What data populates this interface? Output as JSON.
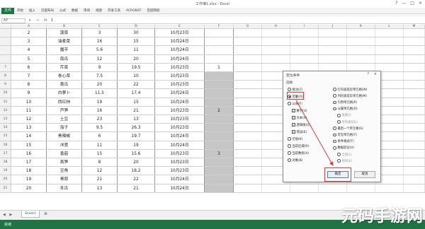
{
  "window": {
    "title": "工作簿1.xlsx - Excel",
    "controls": [
      "?",
      "—",
      "□",
      "×"
    ]
  },
  "ribbon": {
    "file_tab": "文件",
    "tabs": [
      "开始",
      "插入",
      "页面布局",
      "公式",
      "数据",
      "审阅",
      "视图",
      "开发工具",
      "ACROBAT",
      "百度网盘"
    ]
  },
  "formula_bar": {
    "name_box": "A7",
    "icons": "× ✓",
    "fx": "fx",
    "value": "1"
  },
  "columns": [
    "",
    "A",
    "B",
    "C",
    "D",
    "E",
    "F",
    "G",
    "H",
    "I",
    "J",
    "K",
    "L",
    "M",
    "N"
  ],
  "rows": [
    {
      "num": "",
      "a": "2",
      "b": "菠菜",
      "c": "3",
      "d": "30",
      "e": "10月23日",
      "f": ""
    },
    {
      "num": "",
      "a": "3",
      "b": "油麦菜",
      "c": "16",
      "d": "15",
      "e": "10月24日",
      "f": ""
    },
    {
      "num": "",
      "a": "4",
      "b": "魔芋",
      "c": "5.6",
      "d": "11",
      "e": "10月24日",
      "f": ""
    },
    {
      "num": "",
      "a": "5",
      "b": "南瓜",
      "c": "12",
      "d": "20",
      "e": "10月24日",
      "f": ""
    },
    {
      "num": "7",
      "a": "6",
      "b": "芹菜",
      "c": "9",
      "d": "19.5",
      "e": "10月23日",
      "f": "1"
    },
    {
      "num": "8",
      "a": "7",
      "b": "卷心菜",
      "c": "7.5",
      "d": "10",
      "e": "10月23日",
      "f": ""
    },
    {
      "num": "9",
      "a": "8",
      "b": "黄瓜",
      "c": "20",
      "d": "22",
      "e": "10月23日",
      "f": ""
    },
    {
      "num": "10",
      "a": "9",
      "b": "白萝卜",
      "c": "11.5",
      "d": "17.4",
      "e": "10月24日",
      "f": ""
    },
    {
      "num": "11",
      "a": "10",
      "b": "西红柿",
      "c": "19",
      "d": "15",
      "e": "10月24日",
      "f": ""
    },
    {
      "num": "12",
      "a": "11",
      "b": "芦笋",
      "c": "16",
      "d": "21",
      "e": "10月23日",
      "f": "2"
    },
    {
      "num": "13",
      "a": "12",
      "b": "土豆",
      "c": "23",
      "d": "13",
      "e": "10月23日",
      "f": ""
    },
    {
      "num": "14",
      "a": "13",
      "b": "茄子",
      "c": "9.5",
      "d": "26.3",
      "e": "10月23日",
      "f": ""
    },
    {
      "num": "15",
      "a": "14",
      "b": "青辣椒",
      "c": "6",
      "d": "19.7",
      "e": "10月24日",
      "f": ""
    },
    {
      "num": "16",
      "a": "15",
      "b": "洋葱",
      "c": "11",
      "d": "19",
      "e": "10月24日",
      "f": ""
    },
    {
      "num": "17",
      "a": "16",
      "b": "香菇",
      "c": "15",
      "d": "15.6",
      "e": "10月23日",
      "f": "3"
    },
    {
      "num": "18",
      "a": "17",
      "b": "莴笋",
      "c": "8",
      "d": "20",
      "e": "10月23日",
      "f": ""
    },
    {
      "num": "19",
      "a": "18",
      "b": "豆角",
      "c": "12",
      "d": "18.2",
      "e": "10月23日",
      "f": ""
    },
    {
      "num": "20",
      "a": "19",
      "b": "青蒜",
      "c": "21",
      "d": "22",
      "e": "10月24日",
      "f": ""
    },
    {
      "num": "21",
      "a": "20",
      "b": "冬瓜",
      "c": "13",
      "d": "21",
      "e": "10月24日",
      "f": ""
    }
  ],
  "sheet_tabs": {
    "nav": "◀ ▶",
    "active": "Sheet1",
    "add": "⊕"
  },
  "status": {
    "ready": "就绪"
  },
  "dialog": {
    "title": "定位条件",
    "help": "?",
    "close": "×",
    "section": "选择",
    "left_options": [
      {
        "label": "批注(C)",
        "type": "radio",
        "on": false,
        "indent": false,
        "disabled": false
      },
      {
        "label": "常量(O)",
        "type": "radio",
        "on": true,
        "indent": false,
        "disabled": false
      },
      {
        "label": "公式(F)",
        "type": "radio",
        "on": false,
        "indent": false,
        "disabled": false
      },
      {
        "label": "数字(U)",
        "type": "check",
        "on": true,
        "indent": true,
        "disabled": false
      },
      {
        "label": "文本(X)",
        "type": "check",
        "on": true,
        "indent": true,
        "disabled": false
      },
      {
        "label": "逻辑值(G)",
        "type": "check",
        "on": true,
        "indent": true,
        "disabled": false
      },
      {
        "label": "错误(E)",
        "type": "check",
        "on": true,
        "indent": true,
        "disabled": false
      },
      {
        "label": "空值(K)",
        "type": "radio",
        "on": false,
        "indent": false,
        "disabled": false
      },
      {
        "label": "当前区域(R)",
        "type": "radio",
        "on": false,
        "indent": false,
        "disabled": false
      },
      {
        "label": "当前数组(A)",
        "type": "radio",
        "on": false,
        "indent": false,
        "disabled": false
      },
      {
        "label": "对象(B)",
        "type": "radio",
        "on": false,
        "indent": false,
        "disabled": false
      }
    ],
    "right_options": [
      {
        "label": "行内容差异单元格(W)",
        "type": "radio",
        "on": false,
        "indent": false,
        "disabled": false
      },
      {
        "label": "列内容差异单元格(M)",
        "type": "radio",
        "on": false,
        "indent": false,
        "disabled": false
      },
      {
        "label": "引用单元格(P)",
        "type": "radio",
        "on": false,
        "indent": false,
        "disabled": false
      },
      {
        "label": "从属单元格(D)",
        "type": "radio",
        "on": false,
        "indent": false,
        "disabled": false
      },
      {
        "label": "直属(I)",
        "type": "radio",
        "on": false,
        "indent": true,
        "disabled": true
      },
      {
        "label": "所有级别(L)",
        "type": "radio",
        "on": false,
        "indent": true,
        "disabled": true
      },
      {
        "label": "最后一个单元格(S)",
        "type": "radio",
        "on": false,
        "indent": false,
        "disabled": false
      },
      {
        "label": "可见单元格(Y)",
        "type": "radio",
        "on": false,
        "indent": false,
        "disabled": false
      },
      {
        "label": "条件格式(T)",
        "type": "radio",
        "on": false,
        "indent": false,
        "disabled": false
      },
      {
        "label": "数据验证(V)",
        "type": "radio",
        "on": false,
        "indent": false,
        "disabled": false
      },
      {
        "label": "全部(L)",
        "type": "radio",
        "on": false,
        "indent": true,
        "disabled": true
      },
      {
        "label": "相同(E)",
        "type": "radio",
        "on": false,
        "indent": true,
        "disabled": true
      }
    ],
    "ok": "确定",
    "cancel": "取消"
  },
  "colors": {
    "excel_green": "#217346",
    "highlight_red": "#e23b3b",
    "selection_gray": "#c6c6c6"
  },
  "watermark": "元码手游网"
}
